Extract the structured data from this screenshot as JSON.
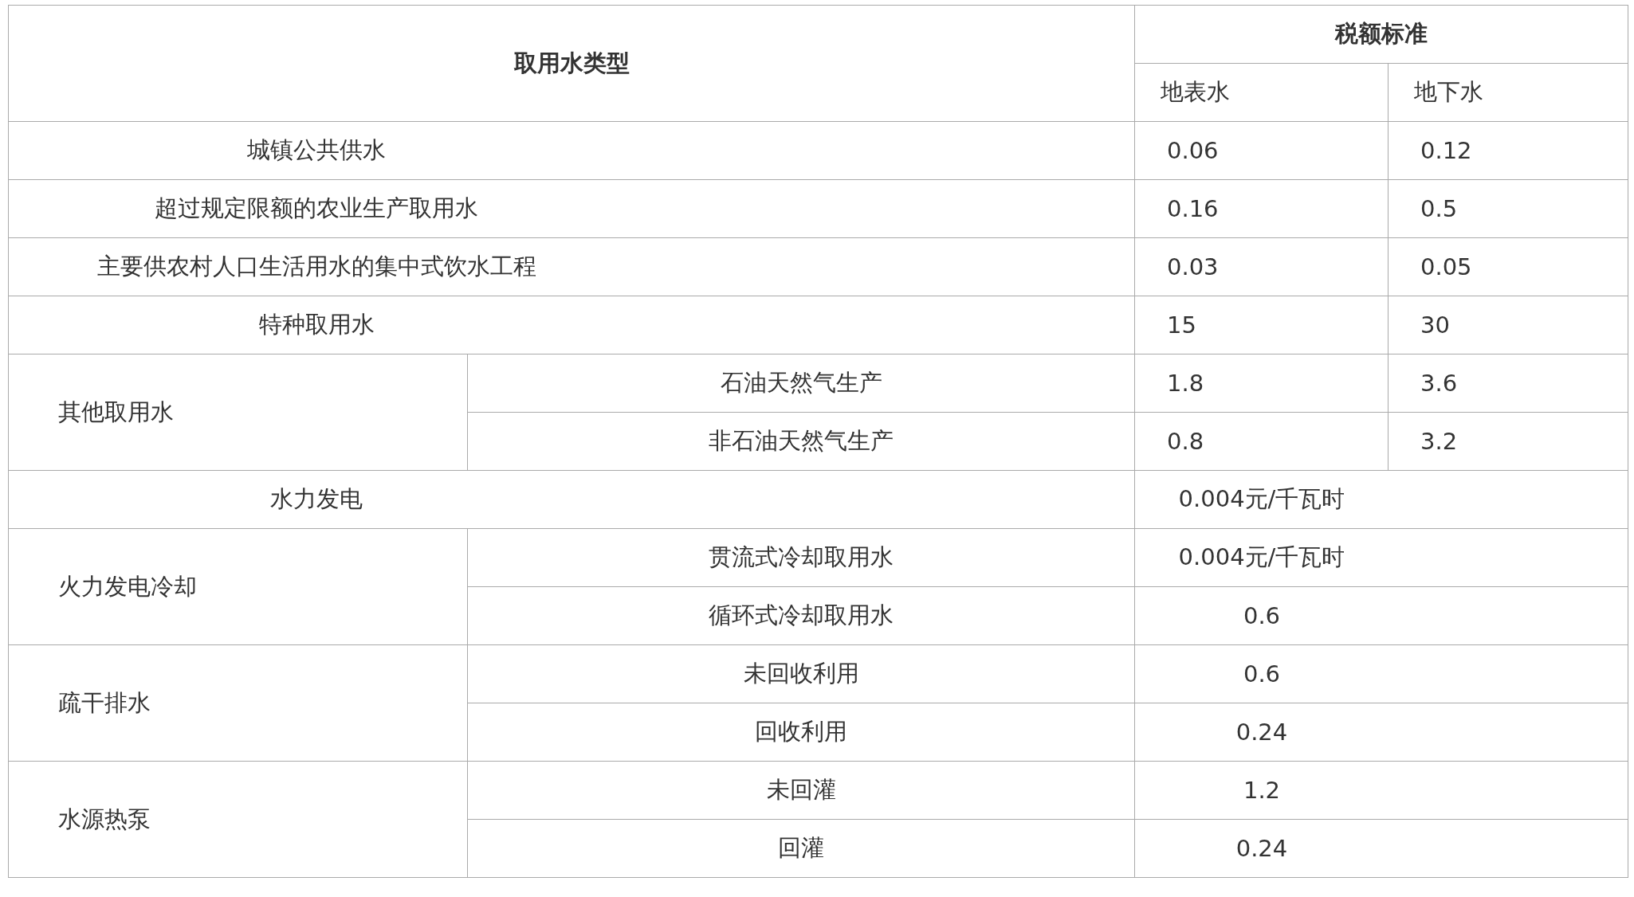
{
  "table": {
    "columns": {
      "type": "取用水类型",
      "rate_group": "税额标准",
      "rate_columns": [
        "地表水",
        "地下水"
      ]
    },
    "rows": [
      {
        "label": "城镇公共供水",
        "values": [
          "0.06",
          "0.12"
        ]
      },
      {
        "label": "超过规定限额的农业生产取用水",
        "values": [
          "0.16",
          "0.5"
        ]
      },
      {
        "label": "主要供农村人口生活用水的集中式饮水工程",
        "values": [
          "0.03",
          "0.05"
        ]
      },
      {
        "label": "特种取用水",
        "values": [
          "15",
          "30"
        ]
      },
      {
        "label": "其他取用水",
        "children": [
          {
            "label": "石油天然气生产",
            "values": [
              "1.8",
              "3.6"
            ]
          },
          {
            "label": "非石油天然气生产",
            "values": [
              "0.8",
              "3.2"
            ]
          }
        ]
      },
      {
        "label": "水力发电",
        "values": [
          "0.004元/千瓦时"
        ]
      },
      {
        "label": "火力发电冷却",
        "children": [
          {
            "label": "贯流式冷却取用水",
            "values": [
              "0.004元/千瓦时"
            ]
          },
          {
            "label": "循环式冷却取用水",
            "values": [
              "0.6"
            ]
          }
        ]
      },
      {
        "label": "疏干排水",
        "children": [
          {
            "label": "未回收利用",
            "values": [
              "0.6"
            ]
          },
          {
            "label": "回收利用",
            "values": [
              "0.24"
            ]
          }
        ]
      },
      {
        "label": "水源热泵",
        "children": [
          {
            "label": "未回灌",
            "values": [
              "1.2"
            ]
          },
          {
            "label": "回灌",
            "values": [
              "0.24"
            ]
          }
        ]
      }
    ]
  }
}
